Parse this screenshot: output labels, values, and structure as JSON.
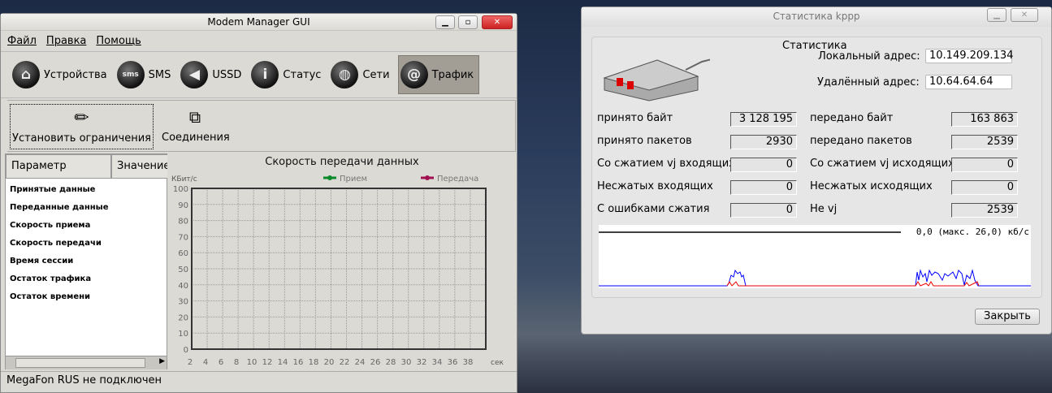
{
  "modem_manager": {
    "title": "Modem Manager GUI",
    "menu": [
      "Файл",
      "Правка",
      "Помощь"
    ],
    "nav": [
      {
        "label": "Устройства",
        "icon": "home-icon"
      },
      {
        "label": "SMS",
        "icon": "sms-icon"
      },
      {
        "label": "USSD",
        "icon": "ussd-icon"
      },
      {
        "label": "Статус",
        "icon": "info-icon"
      },
      {
        "label": "Сети",
        "icon": "globe-icon"
      },
      {
        "label": "Трафик",
        "icon": "at-icon"
      }
    ],
    "toolbar": {
      "limits": "Установить ограничения",
      "connections": "Соединения"
    },
    "table": {
      "headers": [
        "Параметр",
        "Значение"
      ],
      "rows": [
        "Принятые данные",
        "Переданные данные",
        "Скорость приема",
        "Скорость передачи",
        "Время сессии",
        "Остаток трафика",
        "Остаток времени"
      ]
    },
    "chart": {
      "title": "Скорость передачи данных",
      "ylabel": "КБит/с",
      "xlabel": "сек",
      "legend": [
        {
          "name": "Прием",
          "color": "#0a8a2a"
        },
        {
          "name": "Передача",
          "color": "#a01050"
        }
      ],
      "yticks": [
        "0",
        "10",
        "20",
        "30",
        "40",
        "50",
        "60",
        "70",
        "80",
        "90",
        "100"
      ],
      "xticks": [
        "2",
        "4",
        "6",
        "8",
        "10",
        "12",
        "14",
        "16",
        "18",
        "20",
        "22",
        "24",
        "26",
        "28",
        "30",
        "32",
        "34",
        "36",
        "38"
      ]
    },
    "status": "MegaFon RUS не подключен"
  },
  "kppp": {
    "title": "Статистика kppp",
    "heading": "Статистика",
    "local_label": "Локальный адрес:",
    "local": "10.149.209.134",
    "remote_label": "Удалённый адрес:",
    "remote": "10.64.64.64",
    "left": [
      {
        "label": "принято байт",
        "value": "3 128 195"
      },
      {
        "label": "принято пакетов",
        "value": "2930"
      },
      {
        "label": "Со сжатием vj входящих",
        "value": "0"
      },
      {
        "label": "Несжатых входящих",
        "value": "0"
      },
      {
        "label": "С ошибками сжатия",
        "value": "0"
      }
    ],
    "right": [
      {
        "label": "передано байт",
        "value": "163 863"
      },
      {
        "label": "передано пакетов",
        "value": "2539"
      },
      {
        "label": "Со сжатием vj исходящих",
        "value": "0"
      },
      {
        "label": "Несжатых исходящих",
        "value": "0"
      },
      {
        "label": "Не vj",
        "value": "2539"
      }
    ],
    "graph_label": "0,0 (макс. 26,0) кб/с",
    "close": "Закрыть"
  }
}
